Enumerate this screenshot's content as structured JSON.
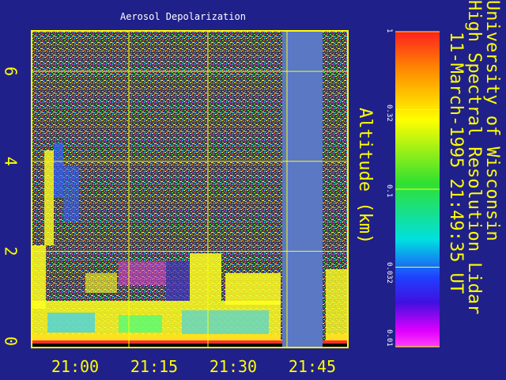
{
  "chart_data": {
    "type": "heatmap",
    "title": "Aerosol Depolarization",
    "ylabel": "Altitude (km)",
    "x_ticks": [
      "21:00",
      "21:15",
      "21:30",
      "21:45"
    ],
    "y_ticks": [
      "0",
      "2",
      "4",
      "6"
    ],
    "ylim": [
      0,
      7
    ],
    "colorbar": {
      "scale": "log",
      "range": [
        0.01,
        1
      ],
      "ticks": [
        "1",
        "0.32",
        "0.1",
        "0.032",
        "0.01"
      ]
    },
    "grid": true
  },
  "header": {
    "line1": "University of Wisconsin",
    "line2": "High Spectral Resolution Lidar",
    "line3": "11-March-1995 21:49:35 UT"
  },
  "colors": {
    "background": "#20208a",
    "frame": "#ffff00",
    "gap": "#5a78c4"
  }
}
